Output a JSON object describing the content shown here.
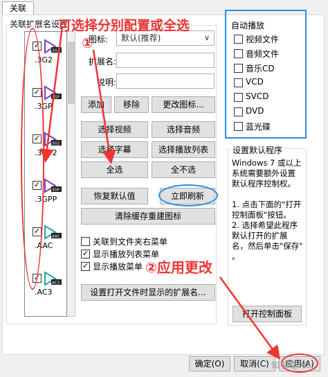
{
  "tab": {
    "label": "关联"
  },
  "group_filetypes": {
    "label": "关联扩展名设置"
  },
  "file_types": [
    {
      "ext": ".3G2",
      "checked": true,
      "badge": "3G2"
    },
    {
      "ext": ".3GP",
      "checked": true,
      "badge": "3GP"
    },
    {
      "ext": ".3GP2",
      "checked": true,
      "badge": "3G2"
    },
    {
      "ext": ".3GPP",
      "checked": true,
      "badge": "3GP"
    },
    {
      "ext": ".AAC",
      "checked": true,
      "badge": "AAC"
    },
    {
      "ext": ".AC3",
      "checked": true,
      "badge": "AC3"
    }
  ],
  "form": {
    "icon_label": "图标:",
    "icon_value": "默认(推荐)",
    "ext_label": "扩展名:",
    "desc_label": "说明:"
  },
  "buttons": {
    "add": "添加",
    "remove": "移除",
    "change_icon": "更改图标...",
    "select_video": "选择视频",
    "select_audio": "选择音频",
    "select_subtitle": "选择字幕",
    "select_playlist": "选择播放列表",
    "select_all": "全选",
    "select_none": "全不选",
    "restore_default": "恢复默认值",
    "refresh_now": "立即刷新",
    "clear_cache": "清除缓存重建图标",
    "set_ext_names": "设置打开文件时显示的扩展名...",
    "open_control_panel": "打开控制面板",
    "ok": "确定(O)",
    "cancel": "取消(C)",
    "apply": "应用(A)"
  },
  "options": [
    {
      "label": "关联到文件夹右菜单",
      "checked": false
    },
    {
      "label": "显示播放列表菜单",
      "checked": true
    },
    {
      "label": "显示播放菜单",
      "checked": true
    }
  ],
  "autoplay": {
    "title": "自动播放",
    "items": [
      {
        "label": "视频文件",
        "checked": false
      },
      {
        "label": "音频文件",
        "checked": false
      },
      {
        "label": "音乐CD",
        "checked": false
      },
      {
        "label": "VCD",
        "checked": false
      },
      {
        "label": "SVCD",
        "checked": false
      },
      {
        "label": "DVD",
        "checked": false
      },
      {
        "label": "蓝光碟",
        "checked": false
      }
    ]
  },
  "default_program": {
    "title": "设置默认程序",
    "lines": [
      "Windows 7 或以上",
      "系统需要额外设置",
      "默认程序控制权。",
      "",
      "1. 点击下面的\"打开",
      "控制面板\"按钮。",
      "2. 选择希望此程序",
      "默认打开的扩展",
      "名，然后单击\"保存\"",
      "。"
    ]
  },
  "annotations": {
    "select_all_hint": "可选择分别配置或全选",
    "marker_1": "①",
    "apply_hint": "②应用更改",
    "watermark": "知乎 @Mo"
  },
  "colors": {
    "annotation_red": "#e33333",
    "annotation_blue": "#2a8fd8",
    "icon_purple": "#7b3fc4",
    "icon_teal": "#1aa5a0"
  }
}
